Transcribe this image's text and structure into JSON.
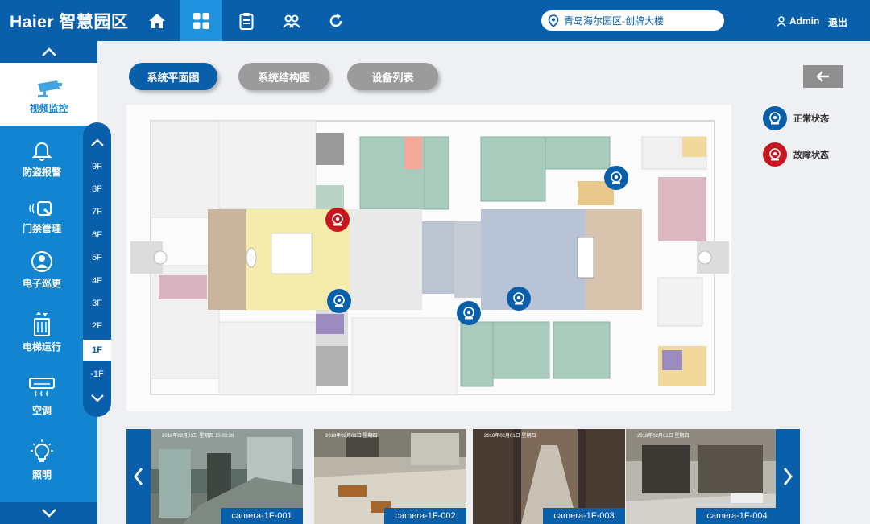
{
  "brand": "Haier 智慧园区",
  "top_nav": [
    {
      "icon": "home-icon",
      "active": false
    },
    {
      "icon": "grid-icon",
      "active": true
    },
    {
      "icon": "clipboard-icon",
      "active": false
    },
    {
      "icon": "group-icon",
      "active": false
    },
    {
      "icon": "refresh-icon",
      "active": false
    }
  ],
  "location": "青岛海尔园区-创牌大楼",
  "user": "Admin",
  "logout": "退出",
  "sidebar": {
    "items": [
      {
        "label": "视频监控",
        "icon": "cctv-camera-icon",
        "active": true
      },
      {
        "label": "防盗报警",
        "icon": "bell-icon",
        "active": false
      },
      {
        "label": "门禁管理",
        "icon": "access-card-icon",
        "active": false
      },
      {
        "label": "电子巡更",
        "icon": "patrol-icon",
        "active": false
      },
      {
        "label": "电梯运行",
        "icon": "elevator-icon",
        "active": false
      },
      {
        "label": "空调",
        "icon": "air-conditioner-icon",
        "active": false
      },
      {
        "label": "照明",
        "icon": "lightbulb-icon",
        "active": false
      }
    ]
  },
  "floors": [
    "9F",
    "8F",
    "7F",
    "6F",
    "5F",
    "4F",
    "3F",
    "2F",
    "1F",
    "-1F"
  ],
  "selected_floor": "1F",
  "tabs": [
    {
      "label": "系统平面图",
      "active": true
    },
    {
      "label": "系统结构图",
      "active": false
    },
    {
      "label": "设备列表",
      "active": false
    }
  ],
  "legend": {
    "normal": "正常状态",
    "fault": "故障状态"
  },
  "map_cameras": [
    {
      "status": "fault"
    },
    {
      "status": "normal"
    },
    {
      "status": "normal"
    },
    {
      "status": "normal"
    },
    {
      "status": "normal"
    }
  ],
  "cameras": [
    {
      "name": "camera-1F-001"
    },
    {
      "name": "camera-1F-002"
    },
    {
      "name": "camera-1F-003"
    },
    {
      "name": "camera-1F-004"
    }
  ],
  "colors": {
    "primary": "#0a5fab",
    "accent": "#1385d0",
    "active_nav": "#1f93de",
    "fault": "#c8161e",
    "tab_inactive": "#9b9b9b"
  }
}
